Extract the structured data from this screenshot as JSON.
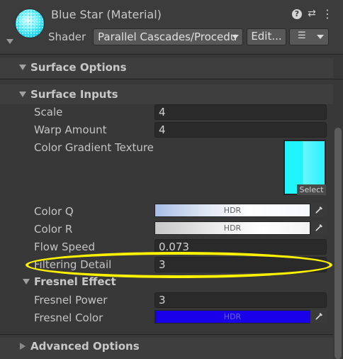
{
  "header": {
    "title": "Blue Star (Material)",
    "shader_label": "Shader",
    "shader_value": "Parallel Cascades/Procedu",
    "edit_label": "Edit...",
    "help_glyph": "?",
    "preset_glyph": "⇄",
    "more_glyph": "⋮",
    "layer_glyph": "☰"
  },
  "sections": {
    "surface_options": {
      "title": "Surface Options",
      "expanded": false
    },
    "surface_inputs": {
      "title": "Surface Inputs",
      "expanded": true
    },
    "fresnel_effect": {
      "title": "Fresnel Effect",
      "expanded": true
    },
    "advanced_options": {
      "title": "Advanced Options",
      "expanded": false
    }
  },
  "props": {
    "scale": {
      "label": "Scale",
      "value": "4"
    },
    "warp_amount": {
      "label": "Warp Amount",
      "value": "4"
    },
    "color_gradient_texture": {
      "label": "Color Gradient Texture",
      "select_label": "Select"
    },
    "color_q": {
      "label": "Color Q",
      "badge": "HDR"
    },
    "color_r": {
      "label": "Color R",
      "badge": "HDR"
    },
    "flow_speed": {
      "label": "Flow Speed",
      "value": "0.073"
    },
    "filtering_detail": {
      "label": "Filtering Detail",
      "value": "3"
    },
    "fresnel_power": {
      "label": "Fresnel Power",
      "value": "3"
    },
    "fresnel_color": {
      "label": "Fresnel Color",
      "badge": "HDR"
    }
  },
  "colors": {
    "highlight": "#fff200",
    "texture_cyan": "#1ff4ff",
    "fresnel_blue": "#1a00e8"
  },
  "icons": {
    "help": "help-icon",
    "preset": "preset-icon",
    "more": "more-options-icon",
    "picker": "eyedropper-icon"
  }
}
